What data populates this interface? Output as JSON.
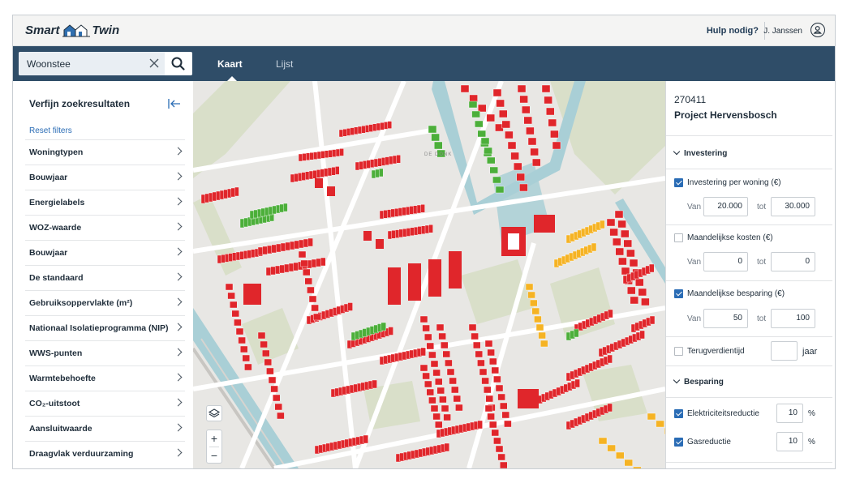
{
  "app": {
    "logo_left": "Smart",
    "logo_right": "Twin",
    "help_label": "Hulp nodig?",
    "user_name": "J. Janssen"
  },
  "search": {
    "value": "Woonstee"
  },
  "tabs": [
    {
      "label": "Kaart",
      "active": true
    },
    {
      "label": "Lijst",
      "active": false
    }
  ],
  "sidebar": {
    "title": "Verfijn zoekresultaten",
    "reset_label": "Reset filters",
    "filters": [
      "Woningtypen",
      "Bouwjaar",
      "Energielabels",
      "WOZ-waarde",
      "Bouwjaar",
      "De standaard",
      "Gebruiksoppervlakte (m²)",
      "Nationaal Isolatieprogramma (NIP)",
      "WWS-punten",
      "Warmtebehoefte",
      "CO₂-uitstoot",
      "Aansluitwaarde",
      "Draagvlak verduurzaming"
    ]
  },
  "map": {
    "area_label": "DE DONK",
    "colors": {
      "red": "#e0262b",
      "green": "#4caf3a",
      "orange": "#f5b324",
      "water": "#a9cfd6",
      "park": "#d9dfc9"
    }
  },
  "panel": {
    "project_id": "270411",
    "project_name": "Project Hervensbosch",
    "section_investering": "Investering",
    "section_besparing": "Besparing",
    "van_label": "Van",
    "tot_label": "tot",
    "rows": [
      {
        "label": "Investering per woning (€)",
        "checked": true,
        "from": "20.000",
        "to": "30.000"
      },
      {
        "label": "Maandelijkse kosten (€)",
        "checked": false,
        "from": "0",
        "to": "0"
      },
      {
        "label": "Maandelijkse besparing (€)",
        "checked": true,
        "from": "50",
        "to": "100"
      }
    ],
    "payback": {
      "label": "Terugverdientijd",
      "checked": false,
      "value": "",
      "unit": "jaar"
    },
    "savings": [
      {
        "label": "Elektriciteitsreductie",
        "checked": true,
        "value": "10",
        "unit": "%"
      },
      {
        "label": "Gasreductie",
        "checked": true,
        "value": "10",
        "unit": "%"
      }
    ]
  }
}
